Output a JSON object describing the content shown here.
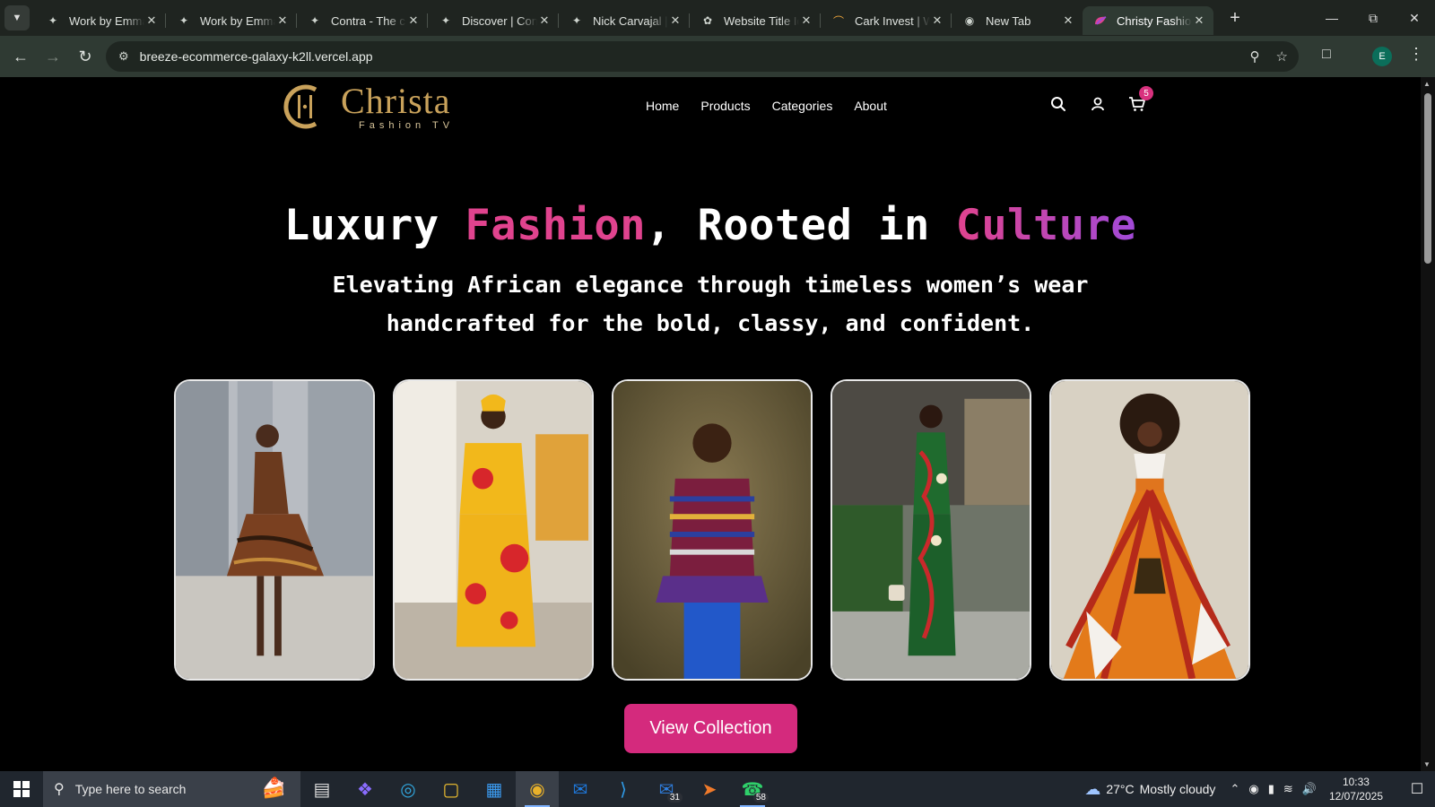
{
  "browser": {
    "tabs": [
      {
        "title": "Work by Emma",
        "icon": "contra-icon"
      },
      {
        "title": "Work by Emma",
        "icon": "contra-icon"
      },
      {
        "title": "Contra - The c",
        "icon": "contra-icon"
      },
      {
        "title": "Discover | Cont",
        "icon": "contra-icon"
      },
      {
        "title": "Nick Carvajal |",
        "icon": "contra-icon"
      },
      {
        "title": "Website Title Ic",
        "icon": "chatgpt-icon"
      },
      {
        "title": "Cark Invest | W",
        "icon": "site-icon"
      },
      {
        "title": "New Tab",
        "icon": "chrome-icon"
      },
      {
        "title": "Christy Fashion",
        "icon": "site-icon",
        "active": true
      }
    ],
    "url": "breeze-ecommerce-galaxy-k2ll.vercel.app",
    "profile_initial": "E"
  },
  "site": {
    "logo": {
      "brand": "Christa",
      "tagline": "Fashion TV",
      "color": "#c9a25b"
    },
    "nav": [
      "Home",
      "Products",
      "Categories",
      "About"
    ],
    "cart_count": "5",
    "hero": {
      "title_parts": [
        "Luxury ",
        "Fashion",
        ", Rooted in ",
        "Culture"
      ],
      "subtitle_line1": "Elevating African elegance through timeless women’s wear",
      "subtitle_line2": "handcrafted for the bold, classy, and confident."
    },
    "gallery": [
      {
        "name": "model-brown-print-dress"
      },
      {
        "name": "model-yellow-red-wrap-dress"
      },
      {
        "name": "model-striped-halter-top"
      },
      {
        "name": "model-green-print-dress"
      },
      {
        "name": "model-orange-print-gown"
      }
    ],
    "cta_label": "View Collection",
    "accent": "#d42a7d"
  },
  "taskbar": {
    "search_placeholder": "Type here to search",
    "badges": {
      "mail": "31",
      "whatsapp": "58"
    },
    "weather": {
      "temp": "27°C",
      "desc": "Mostly cloudy"
    },
    "time": "10:33",
    "date": "12/07/2025"
  }
}
